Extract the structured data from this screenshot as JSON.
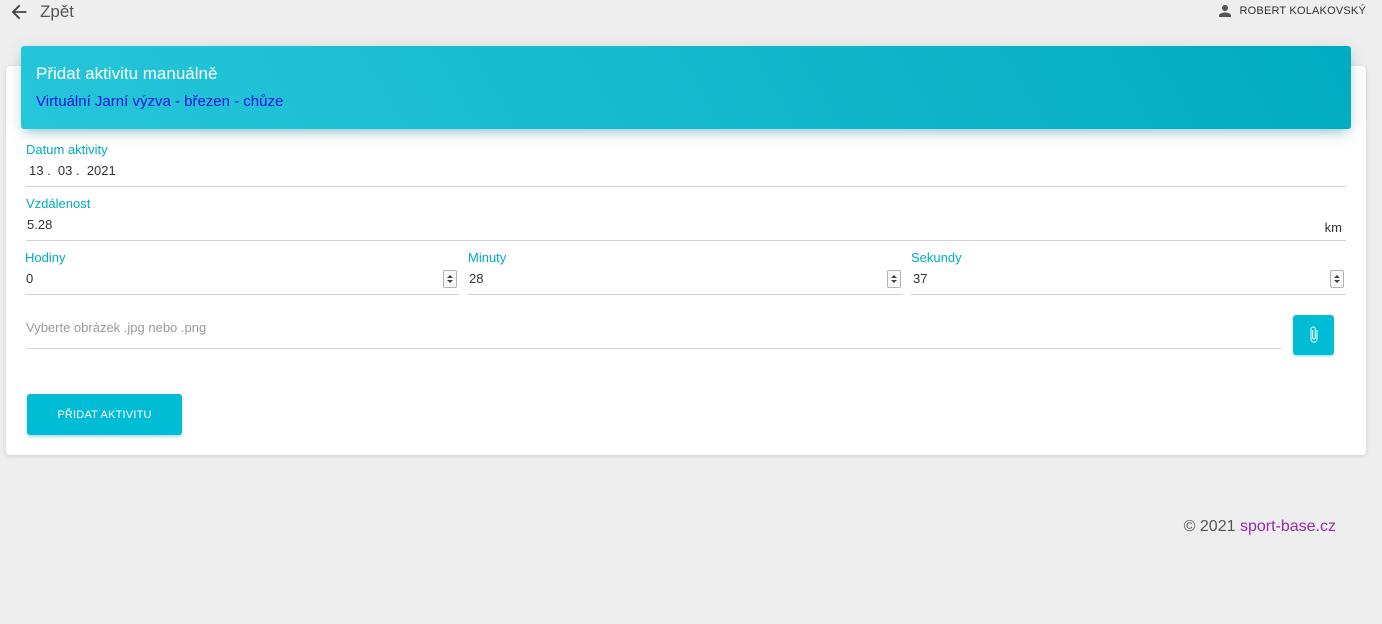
{
  "topbar": {
    "back_label": "Zpět",
    "user_name": "ROBERT KOLAKOVSKÝ"
  },
  "header": {
    "title": "Přidat aktivitu manuálně",
    "subtitle": "Virtuální Jarní výzva - březen - chůze",
    "subtitle_color": "#1a13e6"
  },
  "form": {
    "date": {
      "label": "Datum aktivity",
      "value": "13 .  03 .  2021"
    },
    "distance": {
      "label": "Vzdálenost",
      "value": "5.28",
      "unit": "km"
    },
    "hours": {
      "label": "Hodiny",
      "value": "0"
    },
    "minutes": {
      "label": "Minuty",
      "value": "28"
    },
    "seconds": {
      "label": "Sekundy",
      "value": "37"
    },
    "file": {
      "placeholder": "Vyberte obrázek .jpg nebo .png"
    },
    "submit_label": "PŘIDAT AKTIVITU"
  },
  "footer": {
    "copyright": "© 2021 ",
    "link": "sport-base.cz",
    "link_color": "#9c27b0"
  },
  "colors": {
    "accent": "#00bcd4",
    "label": "#00acc1",
    "background": "#eeeeee"
  },
  "icons": {
    "back": "arrow-left-icon",
    "user": "person-icon",
    "attach": "paperclip-icon"
  }
}
